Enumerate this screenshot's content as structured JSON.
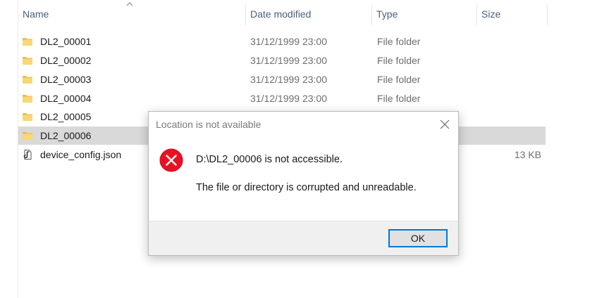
{
  "columns": {
    "name": "Name",
    "date_modified": "Date modified",
    "type": "Type",
    "size": "Size"
  },
  "rows": [
    {
      "name": "DL2_00001",
      "date": "31/12/1999 23:00",
      "type": "File folder",
      "size": "",
      "icon": "folder-icon"
    },
    {
      "name": "DL2_00002",
      "date": "31/12/1999 23:00",
      "type": "File folder",
      "size": "",
      "icon": "folder-icon"
    },
    {
      "name": "DL2_00003",
      "date": "31/12/1999 23:00",
      "type": "File folder",
      "size": "",
      "icon": "folder-icon"
    },
    {
      "name": "DL2_00004",
      "date": "31/12/1999 23:00",
      "type": "File folder",
      "size": "",
      "icon": "folder-icon"
    },
    {
      "name": "DL2_00005",
      "date": "",
      "type": "",
      "size": "",
      "icon": "folder-icon"
    },
    {
      "name": "DL2_00006",
      "date": "",
      "type": "",
      "size": "",
      "icon": "folder-icon",
      "selected": true
    },
    {
      "name": "device_config.json",
      "date": "",
      "type": "",
      "size": "13 KB",
      "icon": "json-file-icon"
    }
  ],
  "dialog": {
    "title": "Location is not available",
    "message_line1": "D:\\DL2_00006 is not accessible.",
    "message_line2": "The file or directory is corrupted and unreadable.",
    "ok_label": "OK",
    "icon": "error-icon"
  },
  "colors": {
    "accent": "#0078d7",
    "error_red": "#e81123",
    "folder_yellow": "#f8d775",
    "selected_row": "#d9d9d9"
  }
}
